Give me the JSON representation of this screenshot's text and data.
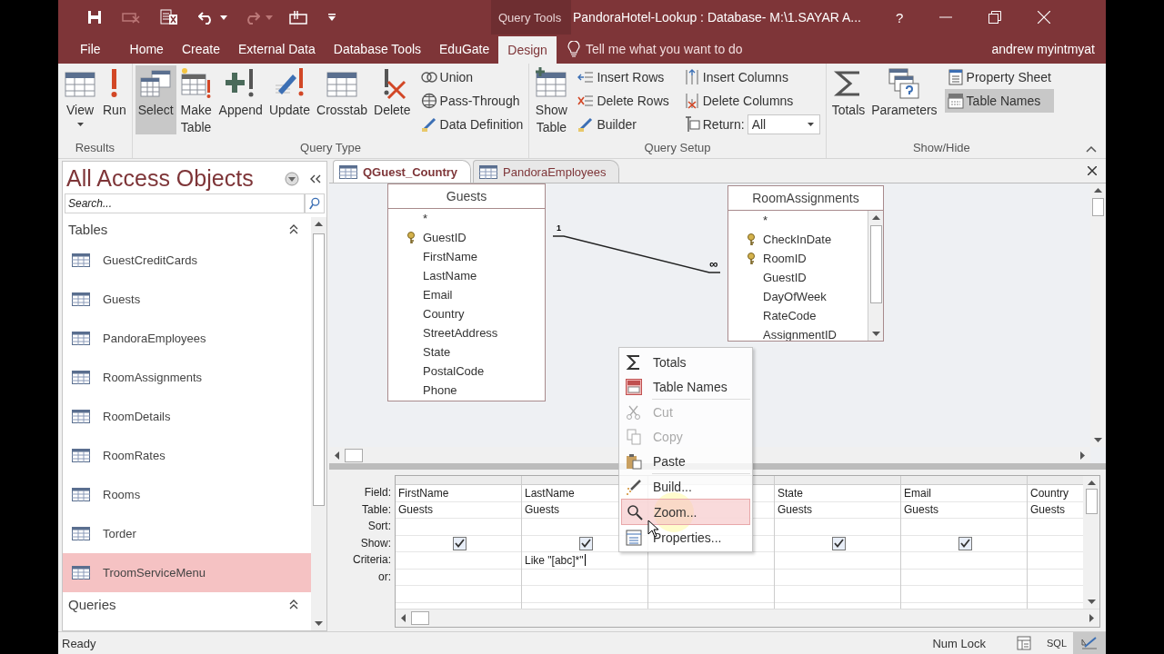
{
  "title_bar": {
    "context_label": "Query Tools",
    "title": "PandoraHotel-Lookup : Database- M:\\1.SAYAR A...",
    "help": "?"
  },
  "ribbon_tabs": [
    {
      "label": "File",
      "selected": false
    },
    {
      "label": "Home",
      "selected": false
    },
    {
      "label": "Create",
      "selected": false
    },
    {
      "label": "External Data",
      "selected": false
    },
    {
      "label": "Database Tools",
      "selected": false
    },
    {
      "label": "EduGate",
      "selected": false
    },
    {
      "label": "Design",
      "selected": true
    }
  ],
  "tell_me": {
    "placeholder": "Tell me what you want to do"
  },
  "user": "andrew myintmyat",
  "ribbon_groups": [
    {
      "title": "Results",
      "large": [
        {
          "label": "View",
          "selected": false,
          "dropdown": true
        },
        {
          "label": "Run",
          "selected": false
        }
      ]
    },
    {
      "title": "Query Type",
      "large": [
        {
          "label": "Select",
          "selected": true
        },
        {
          "label": "Make Table",
          "selected": false
        },
        {
          "label": "Append",
          "selected": false
        },
        {
          "label": "Update",
          "selected": false
        },
        {
          "label": "Crosstab",
          "selected": false
        },
        {
          "label": "Delete",
          "selected": false
        }
      ],
      "small": [
        {
          "label": "Union",
          "selected": false
        },
        {
          "label": "Pass-Through",
          "selected": false
        },
        {
          "label": "Data Definition",
          "selected": false
        }
      ]
    },
    {
      "title": "Query Setup",
      "large": [
        {
          "label": "Show Table",
          "selected": false
        }
      ],
      "small": [
        {
          "label": "Insert Rows",
          "selected": false
        },
        {
          "label": "Delete Rows",
          "selected": false
        },
        {
          "label": "Builder",
          "selected": false
        },
        {
          "label": "Insert Columns",
          "selected": false
        },
        {
          "label": "Delete Columns",
          "selected": false
        }
      ],
      "return": {
        "label": "Return:",
        "value": "All"
      }
    },
    {
      "title": "Show/Hide",
      "large": [
        {
          "label": "Totals",
          "selected": false
        },
        {
          "label": "Parameters",
          "selected": false
        }
      ],
      "small": [
        {
          "label": "Property Sheet",
          "selected": false
        },
        {
          "label": "Table Names",
          "selected": true
        }
      ]
    }
  ],
  "nav_pane": {
    "title": "All Access Objects",
    "search": {
      "placeholder": "Search..."
    },
    "sections": [
      {
        "title": "Tables",
        "items": [
          {
            "label": "GuestCreditCards",
            "selected": false
          },
          {
            "label": "Guests",
            "selected": false
          },
          {
            "label": "PandoraEmployees",
            "selected": false
          },
          {
            "label": "RoomAssignments",
            "selected": false
          },
          {
            "label": "RoomDetails",
            "selected": false
          },
          {
            "label": "RoomRates",
            "selected": false
          },
          {
            "label": "Rooms",
            "selected": false
          },
          {
            "label": "Torder",
            "selected": false
          },
          {
            "label": "TroomServiceMenu",
            "selected": true
          }
        ]
      },
      {
        "title": "Queries"
      }
    ]
  },
  "doc_tabs": [
    {
      "label": "QGuest_Country",
      "selected": true
    },
    {
      "label": "PandoraEmployees",
      "selected": false
    }
  ],
  "field_lists": [
    {
      "title": "Guests",
      "fields": [
        {
          "name": "*",
          "key": false
        },
        {
          "name": "GuestID",
          "key": true
        },
        {
          "name": "FirstName",
          "key": false
        },
        {
          "name": "LastName",
          "key": false
        },
        {
          "name": "Email",
          "key": false
        },
        {
          "name": "Country",
          "key": false
        },
        {
          "name": "StreetAddress",
          "key": false
        },
        {
          "name": "State",
          "key": false
        },
        {
          "name": "PostalCode",
          "key": false
        },
        {
          "name": "Phone",
          "key": false
        }
      ]
    },
    {
      "title": "RoomAssignments",
      "fields": [
        {
          "name": "*",
          "key": false
        },
        {
          "name": "CheckInDate",
          "key": true
        },
        {
          "name": "RoomID",
          "key": true
        },
        {
          "name": "GuestID",
          "key": false
        },
        {
          "name": "DayOfWeek",
          "key": false
        },
        {
          "name": "RateCode",
          "key": false
        },
        {
          "name": "AssignmentID",
          "key": false
        }
      ]
    }
  ],
  "join": {
    "one": "1",
    "many": "∞"
  },
  "grid": {
    "row_labels": [
      "Field:",
      "Table:",
      "Sort:",
      "Show:",
      "Criteria:",
      "or:"
    ],
    "columns": [
      {
        "field": "FirstName",
        "table": "Guests",
        "show": true
      },
      {
        "field": "LastName",
        "table": "Guests",
        "show": true,
        "criteria": "Like \"[abc]*\""
      },
      {},
      {
        "field": "State",
        "table": "Guests",
        "show": true
      },
      {
        "field": "Email",
        "table": "Guests",
        "show": true
      },
      {
        "field": "Country",
        "table": "Guests"
      }
    ]
  },
  "context_menu": {
    "groups": [
      {
        "items": [
          {
            "label": "Totals",
            "disabled": false,
            "selected": false
          },
          {
            "label": "Table Names",
            "disabled": false,
            "selected": false
          }
        ]
      },
      {
        "items": [
          {
            "label": "Cut",
            "disabled": true,
            "selected": false
          },
          {
            "label": "Copy",
            "disabled": true,
            "selected": false
          },
          {
            "label": "Paste",
            "disabled": false,
            "selected": false
          }
        ]
      },
      {
        "items": [
          {
            "label": "Build...",
            "disabled": false,
            "selected": false
          },
          {
            "label": "Zoom...",
            "disabled": false,
            "selected": true
          },
          {
            "label": "Properties...",
            "disabled": false,
            "selected": false
          }
        ]
      }
    ]
  },
  "status_bar": {
    "status": "Ready",
    "num_lock": "Num Lock",
    "views": [
      {
        "kind": "datasheet",
        "selected": false
      },
      {
        "kind": "sql",
        "label": "SQL",
        "selected": false
      },
      {
        "kind": "design",
        "selected": true
      }
    ]
  }
}
